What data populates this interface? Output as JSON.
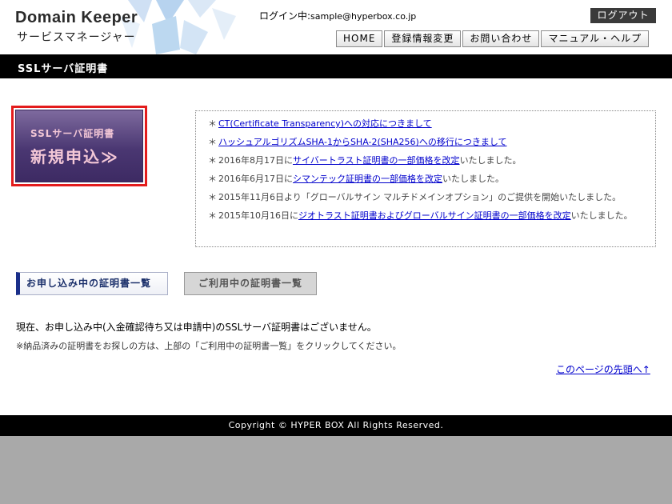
{
  "header": {
    "logo_text": "Domain Keeper",
    "logo_sub": "サービスマネージャー",
    "login_prefix": "ログイン中:",
    "login_email": "sample@hyperbox.co.jp",
    "logout_label": "ログアウト",
    "nav": [
      {
        "label": "HOME"
      },
      {
        "label": "登録情報変更"
      },
      {
        "label": "お問い合わせ"
      },
      {
        "label": "マニュアル・ヘルプ"
      }
    ]
  },
  "page_title": "SSLサーバ証明書",
  "apply_button": {
    "line1": "SSLサーバ証明書",
    "line2": "新規申込≫"
  },
  "news": [
    {
      "prefix": "",
      "link": "CT(Certificate Transparency)への対応につきまして",
      "suffix": ""
    },
    {
      "prefix": "",
      "link": "ハッシュアルゴリズムSHA-1からSHA-2(SHA256)への移行につきまして",
      "suffix": ""
    },
    {
      "prefix": "2016年8月17日に",
      "link": "サイバートラスト証明書の一部価格を改定",
      "suffix": "いたしました。"
    },
    {
      "prefix": "2016年6月17日に",
      "link": "シマンテック証明書の一部価格を改定",
      "suffix": "いたしました。"
    },
    {
      "prefix": "2015年11月6日より「グローバルサイン マルチドメインオプション」のご提供を開始いたしました。",
      "link": "",
      "suffix": ""
    },
    {
      "prefix": "2015年10月16日に",
      "link": "ジオトラスト証明書およびグローバルサイン証明書の一部価格を改定",
      "suffix": "いたしました。"
    }
  ],
  "tabs": {
    "active_label": "お申し込み中の証明書一覧",
    "inactive_label": "ご利用中の証明書一覧"
  },
  "message": {
    "line1": "現在、お申し込み中(入金確認待ち又は申請中)のSSLサーバ証明書はございません。",
    "line2": "※納品済みの証明書をお探しの方は、上部の「ご利用中の証明書一覧」をクリックしてください。"
  },
  "back_to_top": "このページの先頭へ↑",
  "footer": {
    "copyright": "Copyright © HYPER BOX All Rights Reserved."
  },
  "colors": {
    "accent_red": "#e31c1c",
    "apply_purple": "#4a3772",
    "link_blue": "#0000cc",
    "tab_active_bar": "#1a2f8a"
  }
}
